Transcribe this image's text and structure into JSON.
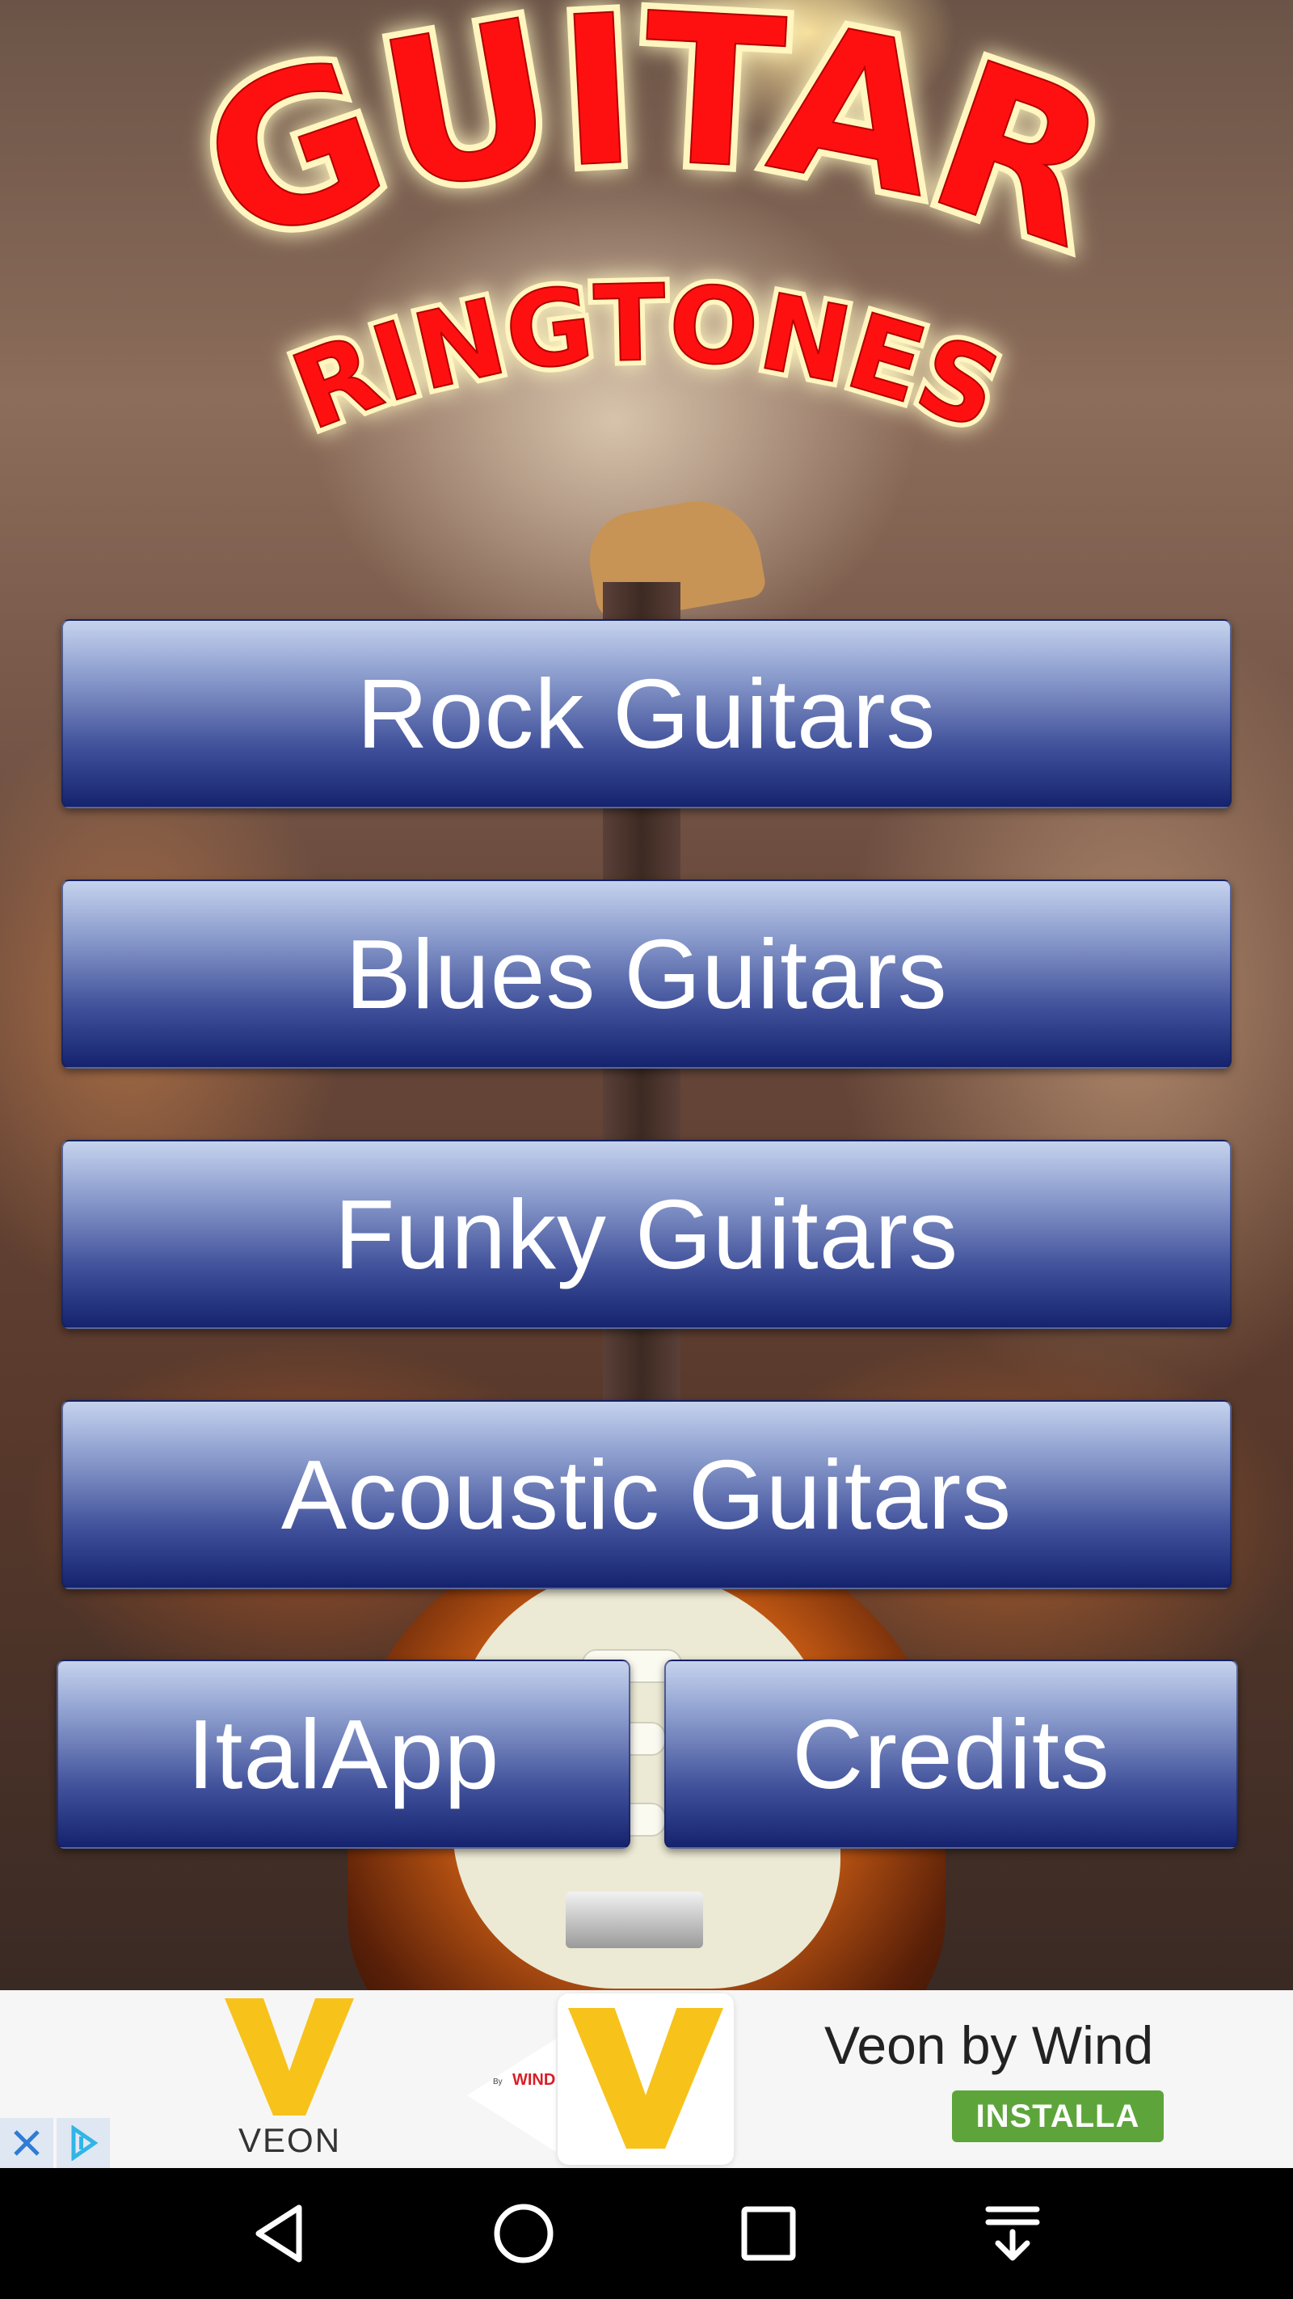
{
  "logo": {
    "line1": "GUITAR",
    "line2": "RINGTONES",
    "fill_color": "#ff1010",
    "glow_color": "#fff7b0"
  },
  "menu": {
    "buttons": [
      {
        "label": "Rock Guitars"
      },
      {
        "label": "Blues Guitars"
      },
      {
        "label": "Funky Guitars"
      },
      {
        "label": "Acoustic Guitars"
      }
    ],
    "italapp_label": "ItalApp",
    "credits_label": "Credits"
  },
  "ad": {
    "brand_text": "VEON",
    "logo_label": "WIND",
    "title": "Veon by Wind",
    "cta": "INSTALLA",
    "accent_color": "#f7c21a",
    "cta_color": "#5da53a",
    "icons": [
      "close-icon",
      "adchoices-icon"
    ]
  },
  "navbar": {
    "icons": [
      "back-icon",
      "home-icon",
      "recents-icon",
      "notification-pull-icon"
    ]
  }
}
